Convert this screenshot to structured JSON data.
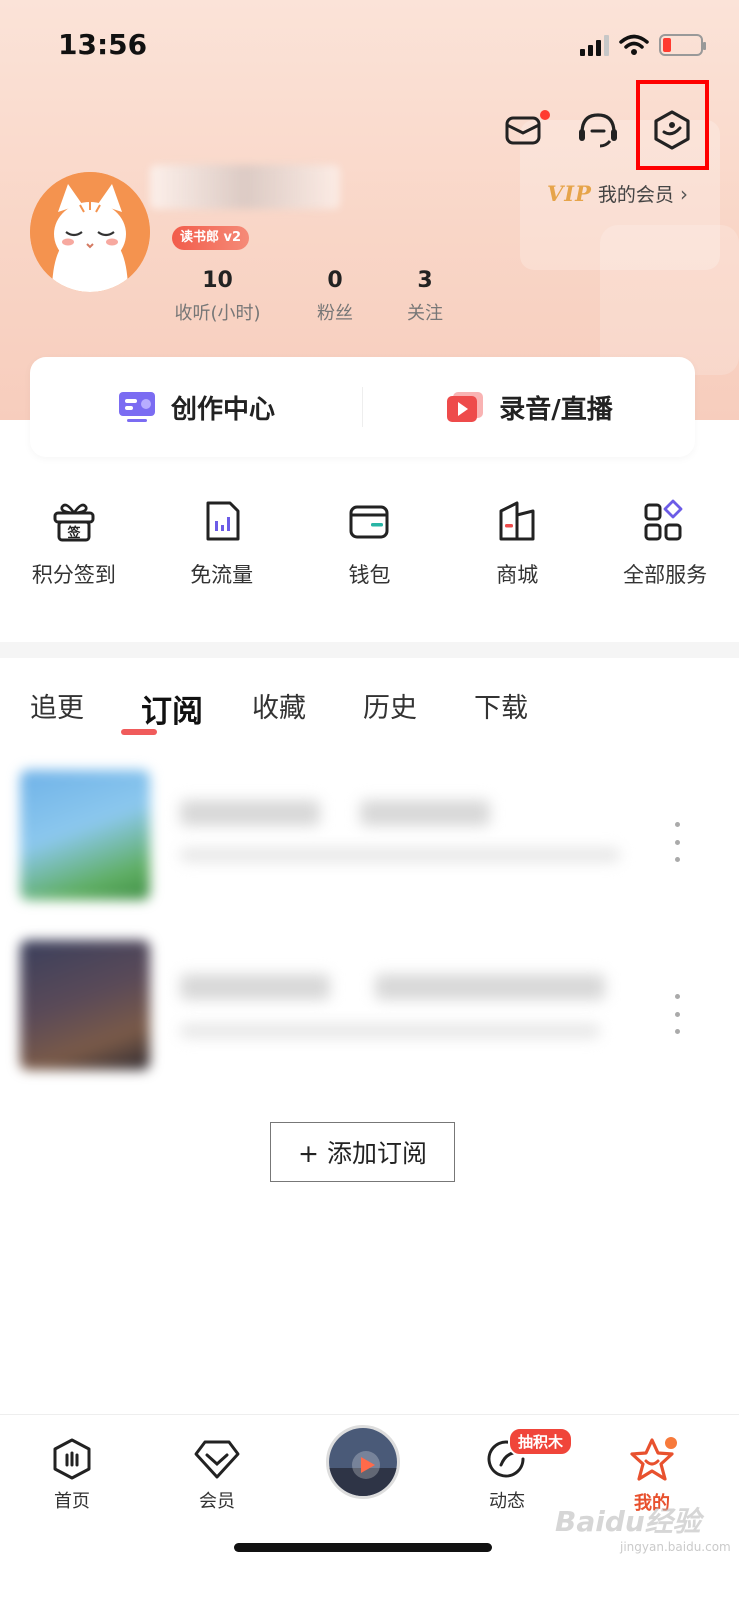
{
  "status_bar": {
    "time": "13:56",
    "battery_level": 0.12
  },
  "colors": {
    "accent": "#e8512e",
    "highlight": "#ff0000",
    "vip_gold": "#e6a44a",
    "tab_indicator": "#f05b5b"
  },
  "top_icons": [
    "mail-icon",
    "headset-icon",
    "settings-icon"
  ],
  "profile": {
    "level_badge": "读书郎 v2",
    "vip_logo": "VIP",
    "vip_link": "我的会员",
    "stats": [
      {
        "value": "10",
        "label": "收听(小时)"
      },
      {
        "value": "0",
        "label": "粉丝"
      },
      {
        "value": "3",
        "label": "关注"
      }
    ]
  },
  "create": {
    "center_label": "创作中心",
    "record_label": "录音/直播"
  },
  "services": [
    {
      "label": "积分签到",
      "icon": "sign-in-gift-icon",
      "glyph": "签"
    },
    {
      "label": "免流量",
      "icon": "data-free-icon"
    },
    {
      "label": "钱包",
      "icon": "wallet-icon"
    },
    {
      "label": "商城",
      "icon": "mall-icon"
    },
    {
      "label": "全部服务",
      "icon": "all-services-icon"
    }
  ],
  "tabs": [
    "追更",
    "订阅",
    "收藏",
    "历史",
    "下载"
  ],
  "active_tab": "订阅",
  "add_subscription": "+ 添加订阅",
  "bottom_nav": {
    "items": [
      {
        "label": "首页",
        "icon": "home-icon"
      },
      {
        "label": "会员",
        "icon": "member-icon"
      },
      {
        "label": "动态",
        "icon": "feed-icon"
      },
      {
        "label": "我的",
        "icon": "profile-star-icon"
      }
    ],
    "badge": "抽积木"
  },
  "watermark": {
    "main": "Baidu经验",
    "sub": "jingyan.baidu.com"
  }
}
